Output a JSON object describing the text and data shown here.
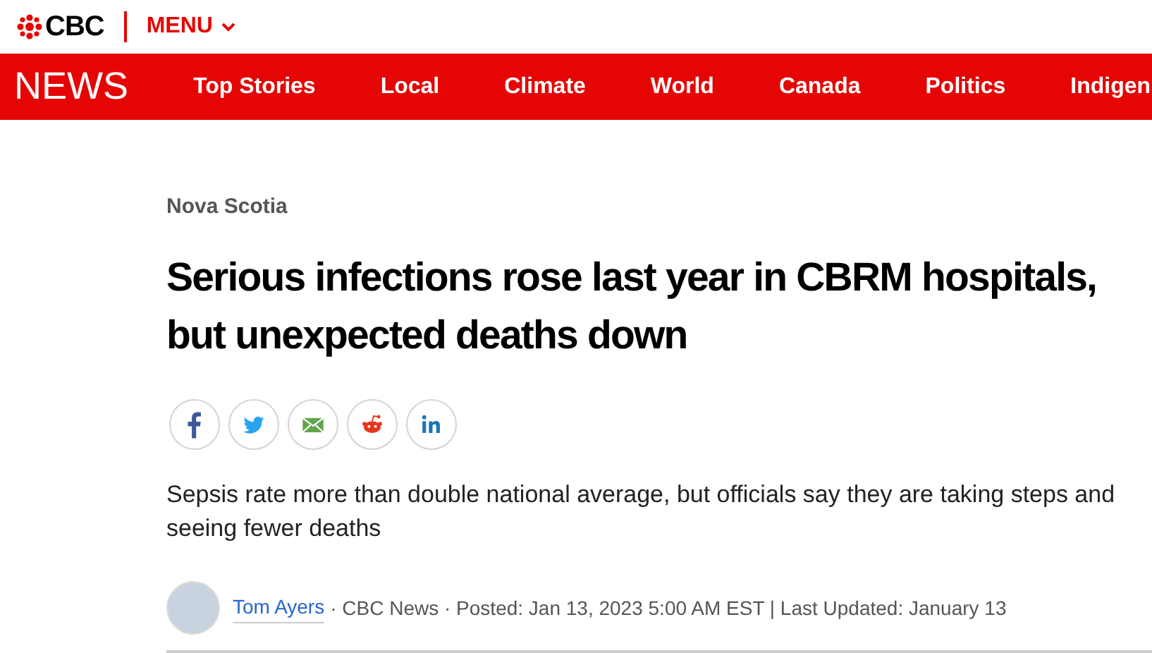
{
  "brand": {
    "logo_text": "CBC",
    "menu_label": "MENU"
  },
  "nav": {
    "section_title": "NEWS",
    "items": [
      {
        "label": "Top Stories"
      },
      {
        "label": "Local"
      },
      {
        "label": "Climate"
      },
      {
        "label": "World"
      },
      {
        "label": "Canada"
      },
      {
        "label": "Politics"
      },
      {
        "label": "Indigen"
      }
    ]
  },
  "article": {
    "section": "Nova Scotia",
    "headline": "Serious infections rose last year in CBRM hospitals, but unexpected deaths down",
    "share_buttons": [
      {
        "kind": "facebook"
      },
      {
        "kind": "twitter"
      },
      {
        "kind": "email"
      },
      {
        "kind": "reddit"
      },
      {
        "kind": "linkedin"
      }
    ],
    "subtitle": "Sepsis rate more than double national average, but officials say they are taking steps and seeing fewer deaths",
    "byline": {
      "author": "Tom Ayers",
      "details": "· CBC News · Posted: Jan 13, 2023 5:00 AM EST | Last Updated: January 13"
    }
  }
}
